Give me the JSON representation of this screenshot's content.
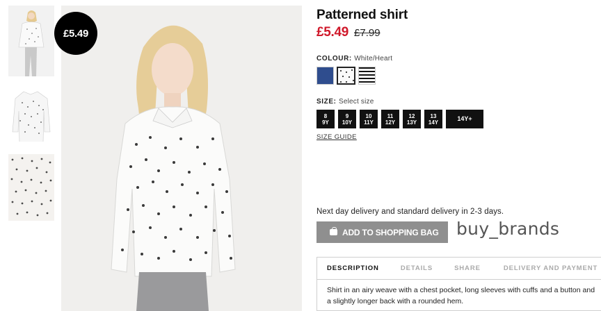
{
  "product": {
    "title": "Patterned shirt",
    "price_now": "£5.49",
    "price_old": "£7.99",
    "badge_price": "£5.49"
  },
  "colour": {
    "label": "COLOUR:",
    "value": "White/Heart",
    "swatches": [
      {
        "name": "navy",
        "color": "#2f4d8e"
      },
      {
        "name": "white-heart",
        "color": "#ffffff",
        "selected": true
      },
      {
        "name": "stripe",
        "color": "#111111"
      }
    ]
  },
  "size": {
    "label": "SIZE:",
    "value": "Select size",
    "options": [
      {
        "top": "8",
        "bottom": "9Y"
      },
      {
        "top": "9",
        "bottom": "10Y"
      },
      {
        "top": "10",
        "bottom": "11Y"
      },
      {
        "top": "11",
        "bottom": "12Y"
      },
      {
        "top": "12",
        "bottom": "13Y"
      },
      {
        "top": "13",
        "bottom": "14Y"
      },
      {
        "top": "14Y+",
        "bottom": ""
      }
    ],
    "guide_label": "SIZE GUIDE"
  },
  "delivery_text": "Next day delivery and standard delivery in 2-3 days.",
  "add_to_bag_label": "ADD TO SHOPPING BAG",
  "watermark": "buy_brands",
  "tabs": [
    "DESCRIPTION",
    "DETAILS",
    "SHARE",
    "DELIVERY AND PAYMENT"
  ],
  "description": "Shirt in an airy weave with a chest pocket, long sleeves with cuffs and a button and a slightly longer back with a rounded hem.",
  "colors": {
    "sale_red": "#d0192b",
    "button_grey": "#8f8f8f",
    "swatch_navy": "#2f4d8e"
  }
}
